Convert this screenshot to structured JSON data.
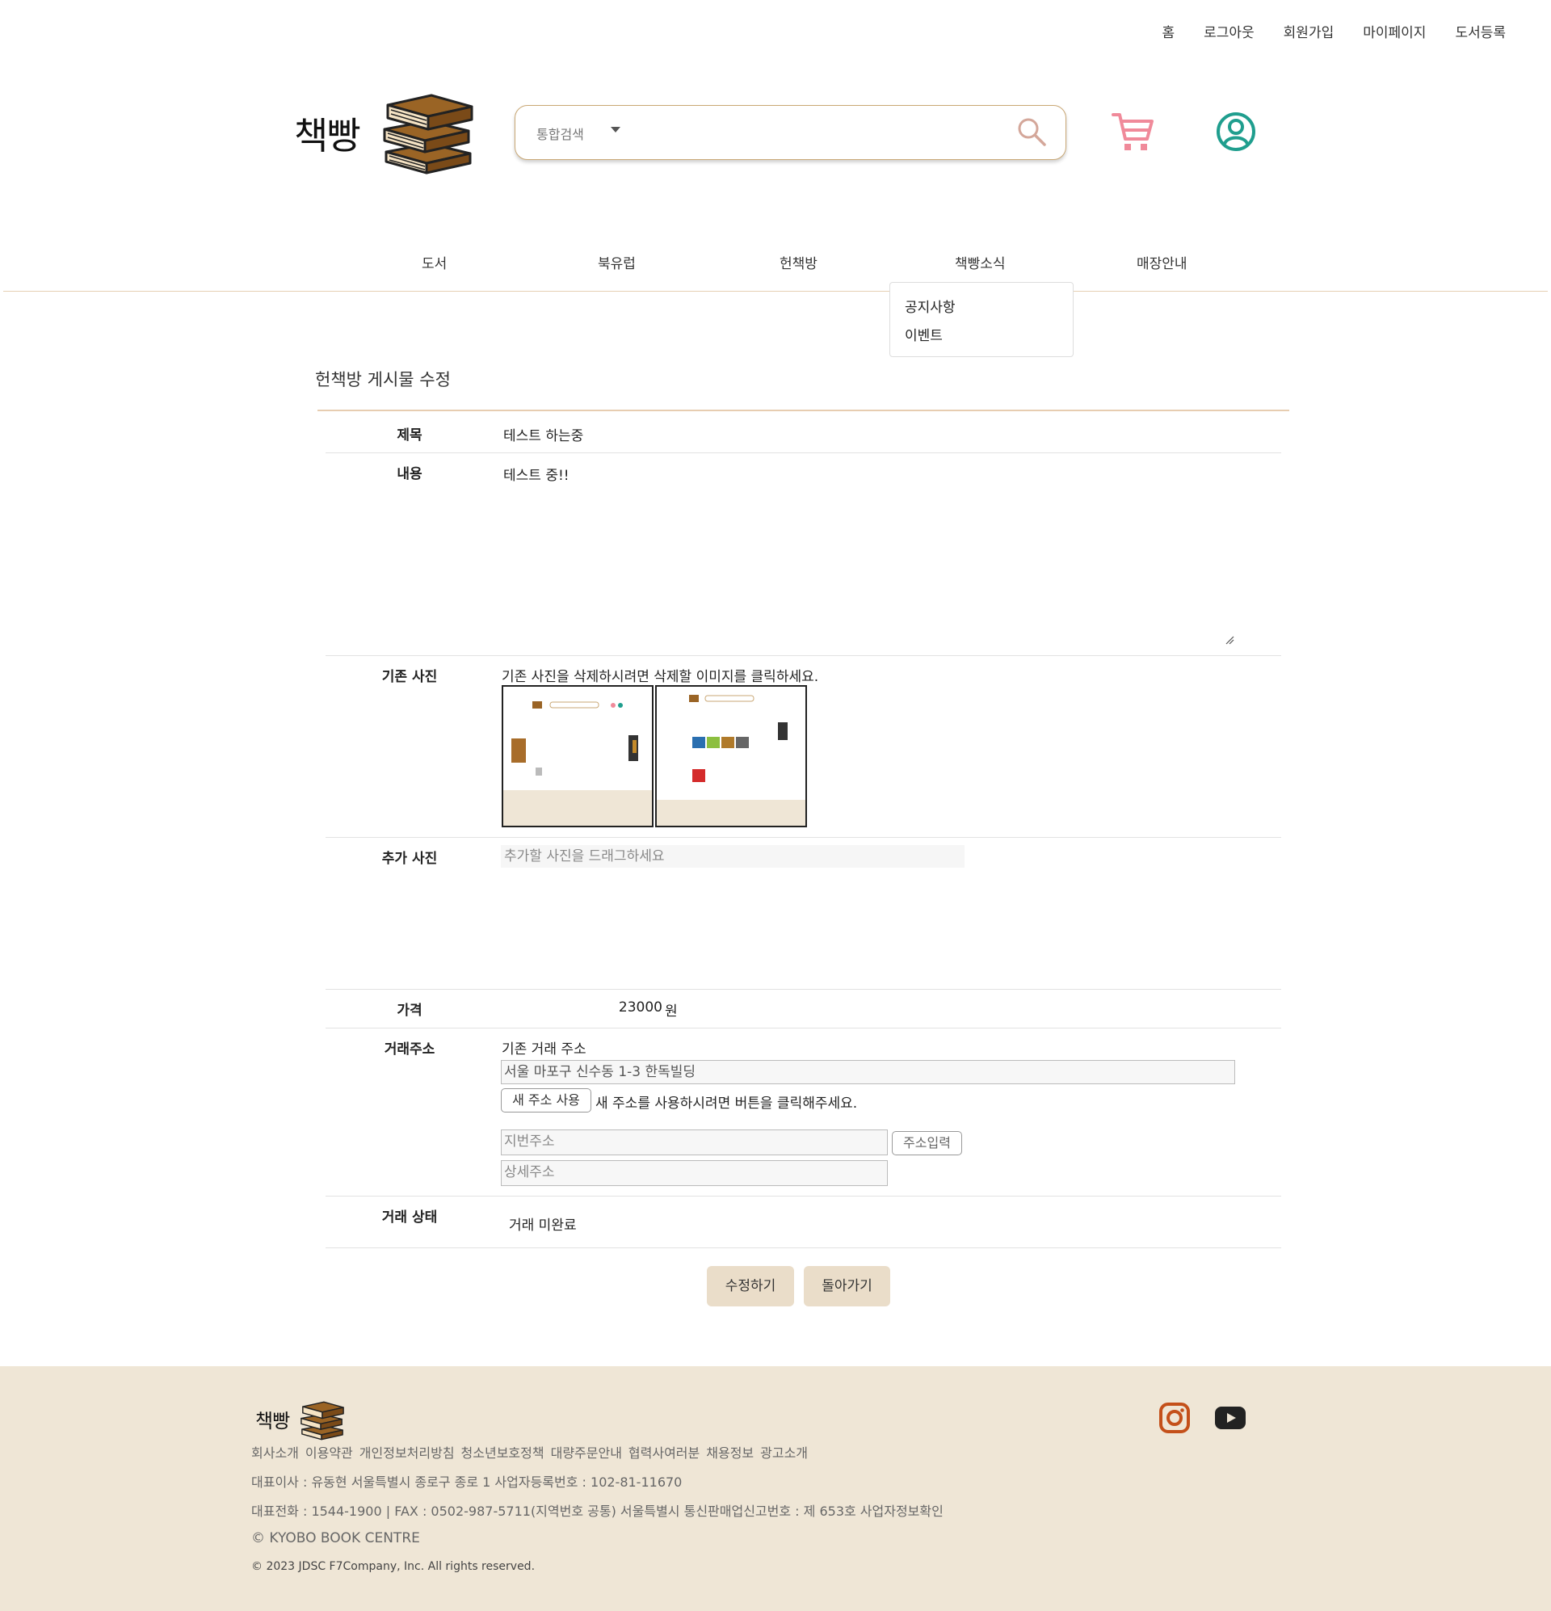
{
  "top_nav": [
    "홈",
    "로그아웃",
    "회원가입",
    "마이페이지",
    "도서등록"
  ],
  "logo": {
    "text": "책빵"
  },
  "search": {
    "category": "통합검색",
    "value": ""
  },
  "main_nav": [
    "도서",
    "북유럽",
    "헌책방",
    "책빵소식",
    "매장안내"
  ],
  "dropdown": [
    "공지사항",
    "이벤트"
  ],
  "form": {
    "page_title": "헌책방 게시물 수정",
    "title_label": "제목",
    "title_value": "테스트 하는중",
    "content_label": "내용",
    "content_value": "테스트 중!!",
    "existing_photo_label": "기존 사진",
    "existing_photo_hint": "기존 사진을 삭제하시려면 삭제할 이미지를 클릭하세요.",
    "add_photo_label": "추가 사진",
    "add_photo_hint": "추가할 사진을 드래그하세요",
    "price_label": "가격",
    "price_value": "23000",
    "price_unit": "원",
    "address_label": "거래주소",
    "existing_address_title": "기존 거래 주소",
    "existing_address": "서울 마포구 신수동 1-3 한독빌딩",
    "new_address_button": "새 주소 사용",
    "new_address_hint": "새 주소를 사용하시려면 버튼을 클릭해주세요.",
    "lot_address_placeholder": "지번주소",
    "address_input_button": "주소입력",
    "detail_address_placeholder": "상세주소",
    "status_label": "거래 상태",
    "status_value": "거래 미완료",
    "submit_button": "수정하기",
    "back_button": "돌아가기"
  },
  "footer": {
    "logo_text": "책빵",
    "links": [
      "회사소개",
      "이용약관",
      "개인정보처리방침",
      "청소년보호정책",
      "대량주문안내",
      "협력사여러분",
      "채용정보",
      "광고소개"
    ],
    "line1": "대표이사 : 유동현 서울특별시 종로구 종로 1 사업자등록번호 : 102-81-11670",
    "line2": "대표전화 : 1544-1900 | FAX : 0502-987-5711(지역번호 공통) 서울특별시 통신판매업신고번호 : 제 653호 사업자정보확인",
    "line3": "© KYOBO BOOK CENTRE",
    "line4": "© 2023 JDSC F7Company, Inc. All rights reserved."
  },
  "colors": {
    "accent": "#c9a774",
    "footer_bg": "#efe6d6",
    "cart": "#f08a9a",
    "user": "#1f9e8e",
    "instagram": "#c4501a"
  },
  "icons": [
    "search-icon",
    "cart-icon",
    "user-icon",
    "instagram-icon",
    "youtube-icon",
    "chevron-down-icon",
    "resize-handle-icon"
  ]
}
